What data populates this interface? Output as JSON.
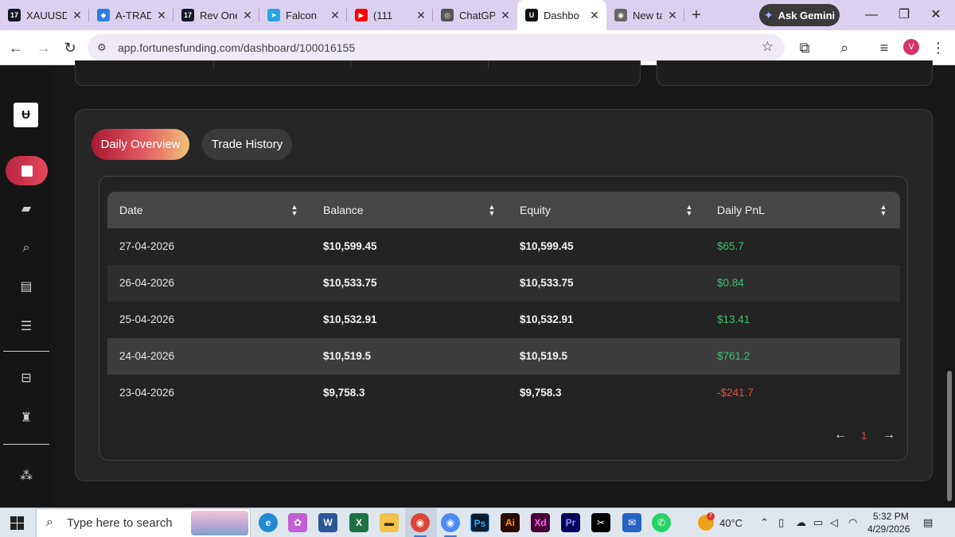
{
  "browser": {
    "tabs": [
      {
        "title": "XAUUSD",
        "fav_text": "17",
        "fav_color": "#131722"
      },
      {
        "title": "A-TRADE",
        "fav_text": "◆",
        "fav_color": "#2f7de1"
      },
      {
        "title": "Rev One",
        "fav_text": "17",
        "fav_color": "#131722"
      },
      {
        "title": "Falcon",
        "fav_text": "➤",
        "fav_color": "#2aa3e0"
      },
      {
        "title": "(111",
        "fav_text": "▶",
        "fav_color": "#ff0000"
      },
      {
        "title": "ChatGPT",
        "fav_text": "◎",
        "fav_color": "#555555"
      },
      {
        "title": "Dashbo",
        "fav_text": "U",
        "fav_color": "#111111"
      },
      {
        "title": "New tab",
        "fav_text": "◉",
        "fav_color": "#666666"
      }
    ],
    "active_tab_index": 6,
    "ask_gemini": "Ask Gemini",
    "url": "app.fortunesfunding.com/dashboard/100016155",
    "profile_initial": "V"
  },
  "tabs": {
    "daily": "Daily Overview",
    "history": "Trade History"
  },
  "table": {
    "headers": [
      "Date",
      "Balance",
      "Equity",
      "Daily PnL"
    ],
    "rows": [
      {
        "date": "27-04-2026",
        "balance": "$10,599.45",
        "equity": "$10,599.45",
        "pnl": "$65.7",
        "positive": true
      },
      {
        "date": "26-04-2026",
        "balance": "$10,533.75",
        "equity": "$10,533.75",
        "pnl": "$0.84",
        "positive": true
      },
      {
        "date": "25-04-2026",
        "balance": "$10,532.91",
        "equity": "$10,532.91",
        "pnl": "$13.41",
        "positive": true
      },
      {
        "date": "24-04-2026",
        "balance": "$10,519.5",
        "equity": "$10,519.5",
        "pnl": "$761.2",
        "positive": true
      },
      {
        "date": "23-04-2026",
        "balance": "$9,758.3",
        "equity": "$9,758.3",
        "pnl": "-$241.7",
        "positive": false
      }
    ],
    "page": "1"
  },
  "colors": {
    "positive": "#3fbf73",
    "negative": "#e84a4a",
    "accent": "#b7263f"
  },
  "taskbar": {
    "search_placeholder": "Type here to search",
    "temperature": "40°C",
    "weather_badge": "7",
    "time": "5:32 PM",
    "date": "4/29/2026"
  }
}
